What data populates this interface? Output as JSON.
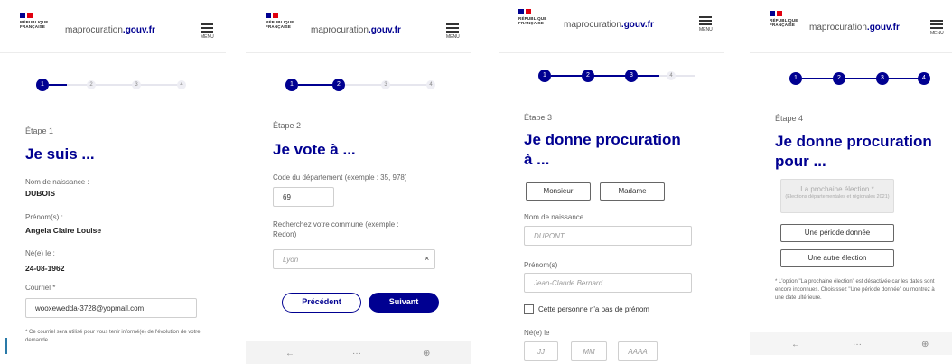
{
  "site": {
    "name": "maprocuration",
    "domain": ".gouv.fr",
    "menu_label": "MENU",
    "logo_text": "RÉPUBLIQUE FRANÇAISE"
  },
  "colors": {
    "primary": "#000091",
    "inactive_step": "#eeeef4"
  },
  "screens": [
    {
      "step": 1,
      "eyebrow": "Étape 1",
      "title": "Je suis ...",
      "fields": [
        {
          "label": "Nom de naissance :",
          "value": "DUBOIS"
        },
        {
          "label": "Prénom(s) :",
          "value": "Angela Claire Louise"
        },
        {
          "label": "Né(e) le :",
          "value": "24-08-1962"
        }
      ],
      "email_label": "Courriel *",
      "email_value": "wooxewedda-3728@yopmail.com",
      "note": "* Ce courriel sera utilisé pour vous tenir informé(e) de l'évolution de votre demande"
    },
    {
      "step": 2,
      "eyebrow": "Étape 2",
      "title": "Je vote à ...",
      "dept_label": "Code du département (exemple : 35, 978)",
      "dept_value": "69",
      "commune_label": "Recherchez votre commune (exemple : Redon)",
      "commune_value": "Lyon",
      "clear_glyph": "×",
      "prev_label": "Précédent",
      "next_label": "Suivant"
    },
    {
      "step": 3,
      "eyebrow": "Étape 3",
      "title_line1": "Je donne procuration",
      "title_line2": "à ...",
      "civility": [
        "Monsieur",
        "Madame"
      ],
      "lastname_label": "Nom de naissance",
      "lastname_placeholder": "DUPONT",
      "firstname_label": "Prénom(s)",
      "firstname_placeholder": "Jean-Claude Bernard",
      "no_firstname_label": "Cette personne n'a pas de prénom",
      "birth_label": "Né(e) le",
      "birth_placeholders": [
        "JJ",
        "MM",
        "AAAA"
      ]
    },
    {
      "step": 4,
      "eyebrow": "Étape 4",
      "title_line1": "Je donne procuration",
      "title_line2": "pour ...",
      "disabled_option_title": "La prochaine élection *",
      "disabled_option_sub": "(Elections départementales et régionales 2021)",
      "option1": "Une période donnée",
      "option2": "Une autre élection",
      "note": "* L'option \"La prochaine élection\" est désactivée car les dates sont encore inconnues. Choisissez \"Une période donnée\" ou montrez à une date ultérieure."
    }
  ],
  "footer_glyphs": {
    "back": "←",
    "dots": "···",
    "tabs": "⊕"
  }
}
